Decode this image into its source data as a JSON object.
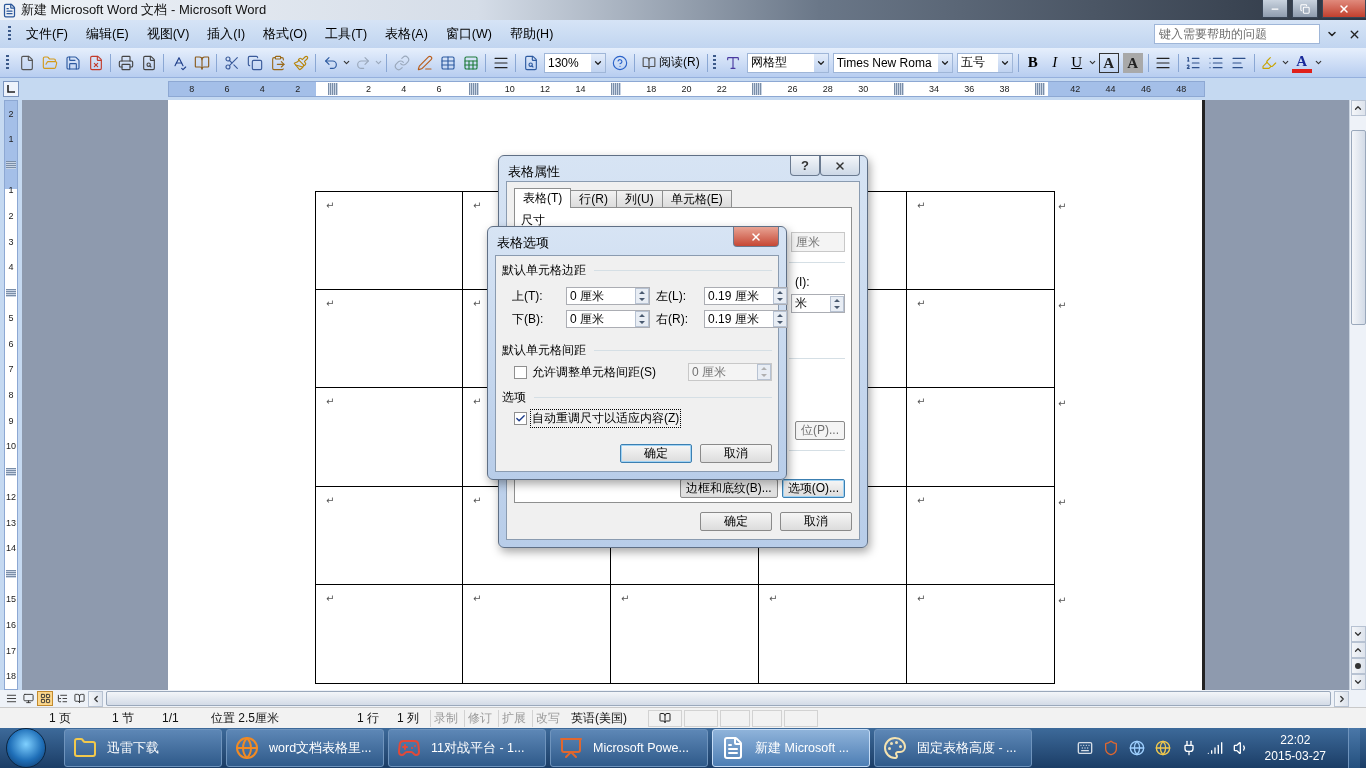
{
  "window": {
    "title": "新建 Microsoft Word 文档 - Microsoft Word"
  },
  "menu": [
    "文件(F)",
    "编辑(E)",
    "视图(V)",
    "插入(I)",
    "格式(O)",
    "工具(T)",
    "表格(A)",
    "窗口(W)",
    "帮助(H)"
  ],
  "help_search": {
    "placeholder": "键入需要帮助的问题"
  },
  "toolbar": {
    "zoom": "130%",
    "read_button": "阅读(R)",
    "style": "网格型",
    "font": "Times New Roma",
    "font_size": "五号",
    "format_buttons": [
      "B",
      "I",
      "U"
    ],
    "char_border": "A",
    "char_shading": "A",
    "font_color": "A"
  },
  "horizontal_ruler": [
    {
      "kind": "number",
      "text": "8"
    },
    {
      "kind": "number",
      "text": "6"
    },
    {
      "kind": "number",
      "text": "4"
    },
    {
      "kind": "number",
      "text": "2"
    },
    {
      "kind": "marker"
    },
    {
      "kind": "number",
      "text": "2"
    },
    {
      "kind": "number",
      "text": "4"
    },
    {
      "kind": "number",
      "text": "6"
    },
    {
      "kind": "marker"
    },
    {
      "kind": "number",
      "text": "10"
    },
    {
      "kind": "number",
      "text": "12"
    },
    {
      "kind": "number",
      "text": "14"
    },
    {
      "kind": "marker"
    },
    {
      "kind": "number",
      "text": "18"
    },
    {
      "kind": "number",
      "text": "20"
    },
    {
      "kind": "number",
      "text": "22"
    },
    {
      "kind": "marker"
    },
    {
      "kind": "number",
      "text": "26"
    },
    {
      "kind": "number",
      "text": "28"
    },
    {
      "kind": "number",
      "text": "30"
    },
    {
      "kind": "marker"
    },
    {
      "kind": "number",
      "text": "34"
    },
    {
      "kind": "number",
      "text": "36"
    },
    {
      "kind": "number",
      "text": "38"
    },
    {
      "kind": "marker"
    },
    {
      "kind": "number",
      "text": "42"
    },
    {
      "kind": "number",
      "text": "44"
    },
    {
      "kind": "number",
      "text": "46"
    },
    {
      "kind": "number",
      "text": "48"
    }
  ],
  "vertical_ruler": [
    {
      "kind": "number",
      "text": "2"
    },
    {
      "kind": "number",
      "text": "1"
    },
    {
      "kind": "marker"
    },
    {
      "kind": "number",
      "text": "1"
    },
    {
      "kind": "number",
      "text": "2"
    },
    {
      "kind": "number",
      "text": "3"
    },
    {
      "kind": "number",
      "text": "4"
    },
    {
      "kind": "marker"
    },
    {
      "kind": "number",
      "text": "5"
    },
    {
      "kind": "number",
      "text": "6"
    },
    {
      "kind": "number",
      "text": "7"
    },
    {
      "kind": "number",
      "text": "8"
    },
    {
      "kind": "number",
      "text": "9"
    },
    {
      "kind": "number",
      "text": "10"
    },
    {
      "kind": "marker"
    },
    {
      "kind": "number",
      "text": "12"
    },
    {
      "kind": "number",
      "text": "13"
    },
    {
      "kind": "number",
      "text": "14"
    },
    {
      "kind": "marker"
    },
    {
      "kind": "number",
      "text": "15"
    },
    {
      "kind": "number",
      "text": "16"
    },
    {
      "kind": "number",
      "text": "17"
    },
    {
      "kind": "number",
      "text": "18"
    }
  ],
  "table": {
    "rows": [
      {
        "cells": [
          "↵",
          "↵",
          null,
          null,
          "↵"
        ],
        "end_mark": "↵"
      },
      {
        "cells": [
          "↵",
          "↵",
          null,
          null,
          "↵"
        ],
        "end_mark": "↵"
      },
      {
        "cells": [
          "↵",
          "↵",
          null,
          null,
          "↵"
        ],
        "end_mark": "↵"
      },
      {
        "cells": [
          "↵",
          "↵",
          null,
          null,
          "↵"
        ],
        "end_mark": "↵"
      },
      {
        "cells": [
          "↵",
          "↵",
          "↵",
          "↵",
          "↵"
        ],
        "end_mark": "↵"
      }
    ]
  },
  "table_properties_dialog": {
    "title": "表格属性",
    "help_glyph": "?",
    "tabs": [
      {
        "label": "表格(T)",
        "selected": true
      },
      {
        "label": "行(R)",
        "selected": false
      },
      {
        "label": "列(U)",
        "selected": false
      },
      {
        "label": "单元格(E)",
        "selected": false
      }
    ],
    "section_label": "尺寸",
    "unit_dropdown": "厘米",
    "indent_label": "(I):",
    "indent_field": "米",
    "position_button": "位(P)...",
    "panel_buttons": [
      {
        "label": "边框和底纹(B)...",
        "default": false
      },
      {
        "label": "选项(O)...",
        "default": true
      }
    ],
    "buttons": [
      {
        "label": "确定",
        "default": false
      },
      {
        "label": "取消",
        "default": false
      }
    ]
  },
  "table_options_dialog": {
    "title": "表格选项",
    "margins_heading": "默认单元格边距",
    "margins": [
      {
        "label": "上(T):",
        "value": "0 厘米"
      },
      {
        "label": "左(L):",
        "value": "0.19 厘米"
      },
      {
        "label": "下(B):",
        "value": "0 厘米"
      },
      {
        "label": "右(R):",
        "value": "0.19 厘米"
      }
    ],
    "spacing_heading": "默认单元格间距",
    "spacing_checkbox": {
      "label": "允许调整单元格间距(S)",
      "checked": false,
      "focused": false
    },
    "spacing_field": {
      "value": "0 厘米",
      "disabled": true
    },
    "options_heading": "选项",
    "autofit_checkbox": {
      "label": "自动重调尺寸以适应内容(Z)",
      "checked": true,
      "focused": true
    },
    "buttons": [
      {
        "label": "确定",
        "default": true
      },
      {
        "label": "取消",
        "default": false
      }
    ]
  },
  "view_buttons": [
    {
      "selected": false
    },
    {
      "selected": false
    },
    {
      "selected": true
    },
    {
      "selected": false
    },
    {
      "selected": false
    }
  ],
  "status_bar": [
    {
      "text": "1 页",
      "disabled": false
    },
    {
      "text": "1 节",
      "disabled": false
    },
    {
      "text": "1/1",
      "disabled": false
    },
    {
      "text": "位置 2.5厘米",
      "disabled": false
    },
    {
      "text": "1 行",
      "disabled": false
    },
    {
      "text": "1 列",
      "disabled": false
    },
    {
      "text": "录制",
      "disabled": true
    },
    {
      "text": "修订",
      "disabled": true
    },
    {
      "text": "扩展",
      "disabled": true
    },
    {
      "text": "改写",
      "disabled": true
    },
    {
      "text": "英语(美国)",
      "disabled": false
    }
  ],
  "taskbar": {
    "items": [
      {
        "label": "迅雷下载",
        "kind": "folder",
        "selected": false
      },
      {
        "label": "word文档表格里...",
        "kind": "browser",
        "selected": false
      },
      {
        "label": "11对战平台 - 1...",
        "kind": "game",
        "selected": false
      },
      {
        "label": "Microsoft Powe...",
        "kind": "slides",
        "selected": false
      },
      {
        "label": "新建 Microsoft ...",
        "kind": "document",
        "selected": true
      },
      {
        "label": "固定表格高度 - ...",
        "kind": "paint",
        "selected": false
      }
    ],
    "clock": {
      "time": "22:02",
      "date": "2015-03-27"
    }
  }
}
